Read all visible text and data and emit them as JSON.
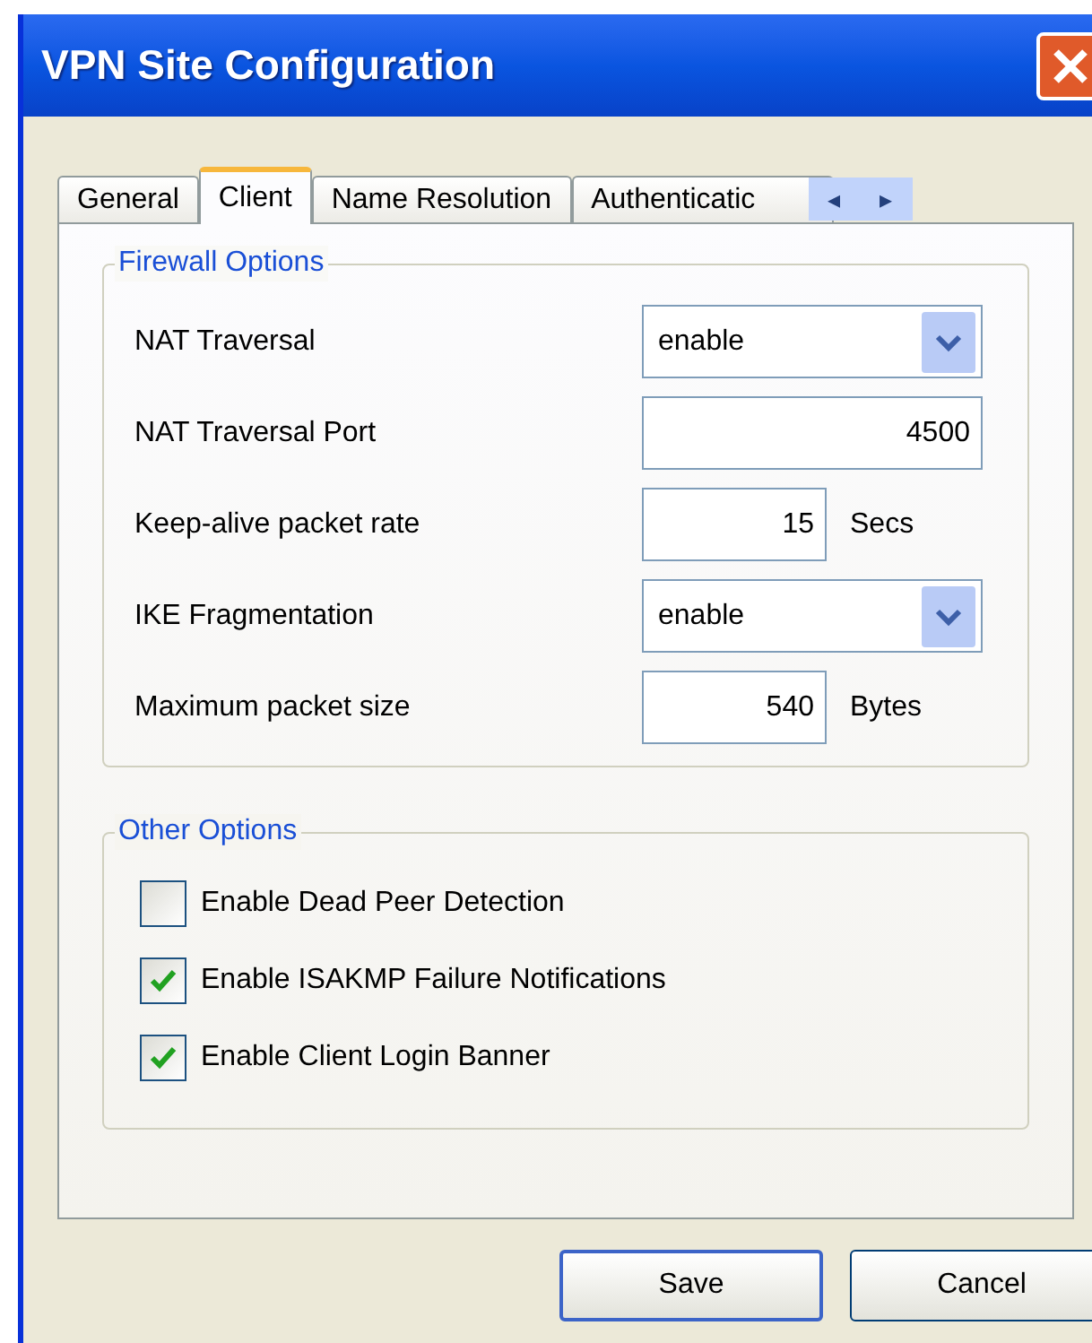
{
  "window": {
    "title": "VPN Site Configuration"
  },
  "tabs": [
    {
      "label": "General",
      "selected": false
    },
    {
      "label": "Client",
      "selected": true
    },
    {
      "label": "Name Resolution",
      "selected": false
    },
    {
      "label": "Authenticatic",
      "selected": false
    }
  ],
  "tab_scroll": {
    "left": "◂",
    "right": "▸"
  },
  "firewall_options": {
    "title": "Firewall Options",
    "rows": [
      {
        "kind": "select",
        "label": "NAT Traversal",
        "value": "enable"
      },
      {
        "kind": "text",
        "label": "NAT Traversal Port",
        "value": "4500"
      },
      {
        "kind": "unit",
        "label": "Keep-alive packet rate",
        "value": "15",
        "unit": "Secs"
      },
      {
        "kind": "select",
        "label": "IKE Fragmentation",
        "value": "enable"
      },
      {
        "kind": "unit",
        "label": "Maximum packet size",
        "value": "540",
        "unit": "Bytes"
      }
    ]
  },
  "other_options": {
    "title": "Other Options",
    "checkboxes": [
      {
        "label": "Enable Dead Peer Detection",
        "checked": false
      },
      {
        "label": "Enable ISAKMP Failure Notifications",
        "checked": true
      },
      {
        "label": "Enable Client Login Banner",
        "checked": true
      }
    ]
  },
  "buttons": [
    "Save",
    "Cancel"
  ]
}
